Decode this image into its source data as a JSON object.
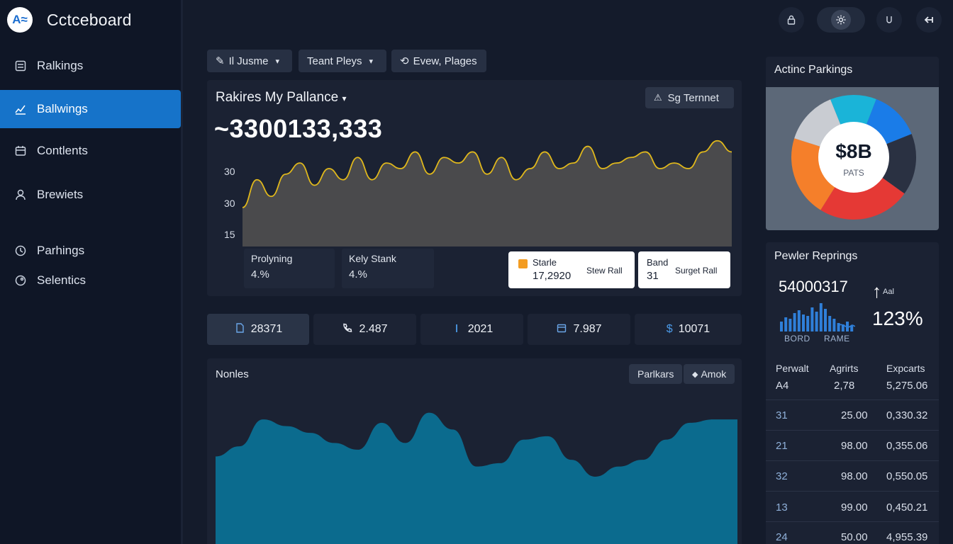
{
  "app": {
    "logo_text": "A≈",
    "name": "Cctceboard"
  },
  "sidebar": {
    "items": [
      {
        "label": "Ralkings",
        "icon": "list-icon",
        "active": false
      },
      {
        "label": "Ballwings",
        "icon": "chart-icon",
        "active": true
      },
      {
        "label": "Contlents",
        "icon": "calendar-icon",
        "active": false
      },
      {
        "label": "Brewiets",
        "icon": "user-icon",
        "active": false
      },
      {
        "label": "Parhings",
        "icon": "clock-icon",
        "active": false
      },
      {
        "label": "Selentics",
        "icon": "tag-icon",
        "active": false
      }
    ]
  },
  "topbar": {
    "icons": [
      "lock-icon",
      "gear-icon",
      "u-icon",
      "logout-icon"
    ]
  },
  "filters": [
    {
      "label": "Il Jusme",
      "icon": "pen-icon",
      "dropdown": true
    },
    {
      "label": "Teant Pleys",
      "icon": "",
      "dropdown": true
    },
    {
      "label": "Evew, Plages",
      "icon": "refresh-icon",
      "dropdown": false
    }
  ],
  "main_chart": {
    "title": "Rakires My Pallance",
    "button_label": "Sg Ternnet",
    "total": "~3300133,333",
    "y_ticks": [
      "30",
      "30",
      "15"
    ],
    "stats": [
      {
        "label": "Prolyning",
        "value": "4.%"
      },
      {
        "label": "Kely Stank",
        "value": "4.%"
      }
    ],
    "cards": [
      {
        "title": "Starle",
        "value": "17,2920",
        "sub": "Stew Rall",
        "icon": "flag-icon"
      },
      {
        "title": "Band",
        "value": "31",
        "sub": "Surget Rall"
      }
    ],
    "chart_data": {
      "type": "area",
      "x": [
        0,
        1,
        2,
        3,
        4,
        5,
        6,
        7,
        8,
        9,
        10,
        11,
        12,
        13,
        14,
        15,
        16,
        17,
        18,
        19,
        20,
        21,
        22,
        23,
        24,
        25,
        26,
        27,
        28,
        29,
        30,
        31,
        32,
        33,
        34
      ],
      "series": [
        {
          "values": [
            19,
            24,
            21,
            25,
            27,
            23,
            26,
            24,
            28,
            24,
            27,
            26,
            29,
            25,
            28,
            27,
            29,
            25,
            28,
            24,
            26,
            29,
            26,
            27,
            30,
            26,
            27,
            28,
            29,
            26,
            27,
            26,
            29,
            31,
            29
          ]
        }
      ],
      "grid": false,
      "colors": {
        "line": "#e0b81c",
        "fill": "#4a4a4c"
      }
    }
  },
  "kpis": [
    {
      "value": "28371",
      "icon": "doc-icon",
      "active": true
    },
    {
      "value": "2.487",
      "icon": "phone-icon",
      "active": false
    },
    {
      "value": "2021",
      "icon": "bar-icon",
      "active": false
    },
    {
      "value": "7.987",
      "icon": "calendar-icon",
      "active": false
    },
    {
      "value": "10071",
      "icon": "dollar-icon",
      "active": false
    }
  ],
  "bottom_chart": {
    "title": "Nonles",
    "buttons": [
      "Parlkars",
      "Amok"
    ],
    "chart_data": {
      "type": "area",
      "x": [
        0,
        1,
        2,
        3,
        4,
        5,
        6,
        7,
        8,
        9,
        10,
        11,
        12,
        13,
        14,
        15,
        16,
        17,
        18,
        19,
        20,
        21,
        22
      ],
      "series": [
        {
          "values": [
            52,
            58,
            74,
            70,
            66,
            60,
            56,
            72,
            60,
            78,
            68,
            46,
            48,
            62,
            64,
            50,
            40,
            46,
            50,
            62,
            72,
            74,
            74
          ]
        }
      ],
      "colors": {
        "fill": "#0b6b8e"
      }
    }
  },
  "donut_panel": {
    "title": "Actinc Parkings",
    "center_value": "$8B",
    "center_label": "PATS",
    "chart_data": {
      "type": "pie",
      "values": [
        12,
        13,
        16,
        24,
        21,
        14
      ],
      "colors": [
        "#1ab4d8",
        "#1a7ce8",
        "#2a3142",
        "#e53935",
        "#f57f2a",
        "#c9ccd2"
      ]
    }
  },
  "summary_panel": {
    "title": "Pewler Reprings",
    "value": "54000317",
    "trend_label": "Aal",
    "percent": "123%",
    "mini_labels": [
      "BORD",
      "RAME"
    ],
    "table": {
      "headers": [
        "Perwalt",
        "Agrirts",
        "Expcarts"
      ],
      "rows": [
        [
          "A4",
          "2,78",
          "5,275.06"
        ],
        [
          "31",
          "25.00",
          "0,330.32"
        ],
        [
          "21",
          "98.00",
          "0,355.06"
        ],
        [
          "32",
          "98.00",
          "0,550.05"
        ],
        [
          "13",
          "99.00",
          "0,450.21"
        ],
        [
          "24",
          "50.00",
          "4,955.39"
        ]
      ]
    }
  }
}
